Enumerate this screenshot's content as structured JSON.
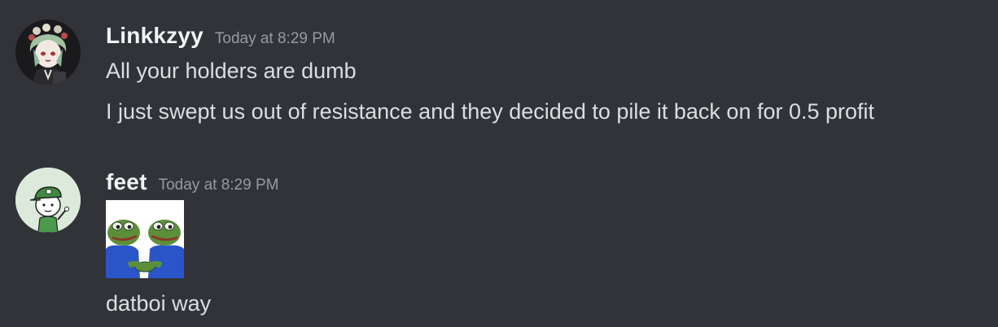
{
  "messages": [
    {
      "author": "Linkkzyy",
      "timestamp": "Today at 8:29 PM",
      "avatar_icon": "anime-character-avatar-icon",
      "lines": [
        "All your holders are dumb",
        "I just swept us out of resistance and they decided to pile it back on for 0.5 profit"
      ]
    },
    {
      "author": "feet",
      "timestamp": "Today at 8:29 PM",
      "avatar_icon": "cartoon-green-cap-avatar-icon",
      "sticker_icon": "pepe-frogs-holding-hands-sticker-icon",
      "lines": [
        "datboi way"
      ]
    }
  ],
  "colors": {
    "background": "#313338",
    "username": "#f2f3f5",
    "timestamp": "#949ba4",
    "message_text": "#dbdee1"
  }
}
